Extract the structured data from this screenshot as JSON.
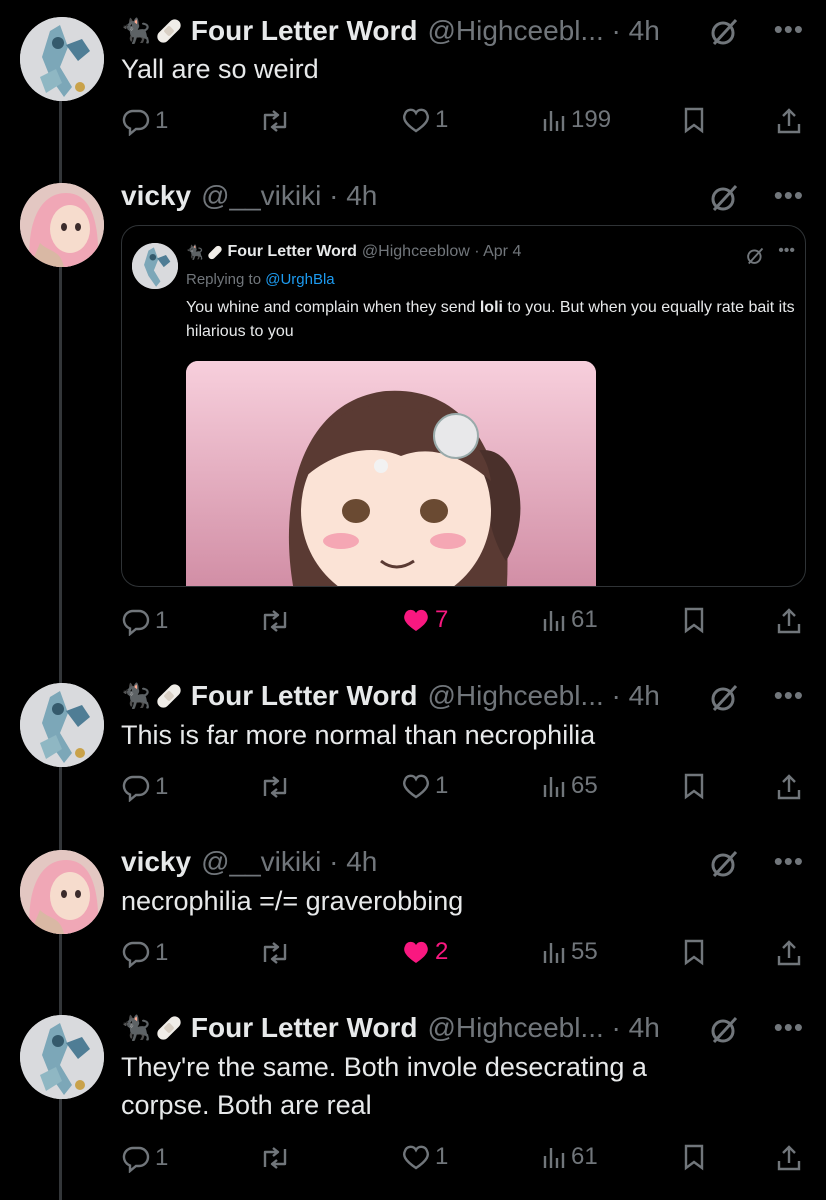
{
  "tweets": [
    {
      "display_name": "Four Letter Word",
      "handle": "@Highceebl... · 4h",
      "text": "Yall are so weird",
      "reply_count": "1",
      "retweet_count": "",
      "like_count": "1",
      "view_count": "199",
      "liked": false
    },
    {
      "display_name": "vicky",
      "handle": "@__vikiki · 4h",
      "text": "",
      "reply_count": "1",
      "retweet_count": "",
      "like_count": "7",
      "view_count": "61",
      "liked": true
    },
    {
      "display_name": "Four Letter Word",
      "handle": "@Highceebl... · 4h",
      "text": "This is far more normal than necrophilia",
      "reply_count": "1",
      "retweet_count": "",
      "like_count": "1",
      "view_count": "65",
      "liked": false
    },
    {
      "display_name": "vicky",
      "handle": "@__vikiki · 4h",
      "text": "necrophilia =/= graverobbing",
      "reply_count": "1",
      "retweet_count": "",
      "like_count": "2",
      "view_count": "55",
      "liked": true
    },
    {
      "display_name": "Four Letter Word",
      "handle": "@Highceebl... · 4h",
      "text": "They're the same. Both invole desecrating a corpse. Both are real",
      "reply_count": "1",
      "retweet_count": "",
      "like_count": "1",
      "view_count": "61",
      "liked": false
    }
  ],
  "quote": {
    "display_name": "Four Letter Word",
    "handle": "@Highceeblow · Apr 4",
    "replying_prefix": "Replying to ",
    "replying_to": "@UrghBla",
    "text_before": "You whine and complain when they send ",
    "text_bold": "loli",
    "text_after": " to you. But when you equally rate bait its hilarious to you"
  },
  "colors": {
    "background": "#000000",
    "text": "#e7e9ea",
    "muted": "#71767b",
    "like_active": "#f91880",
    "link": "#1d9bf0"
  },
  "icons": [
    "cat-emoji-icon",
    "bandage-emoji-icon",
    "grok-icon",
    "more-icon",
    "reply-icon",
    "retweet-icon",
    "like-icon",
    "views-icon",
    "bookmark-icon",
    "share-icon"
  ]
}
